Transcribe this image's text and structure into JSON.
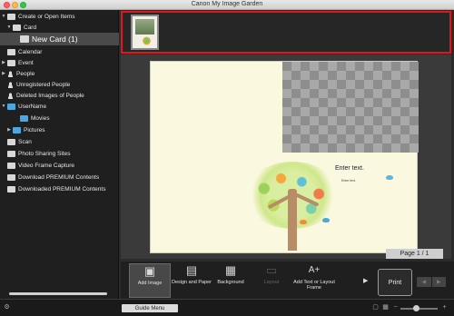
{
  "window": {
    "title": "Canon My Image Garden"
  },
  "sidebar": {
    "items": [
      {
        "label": "Create or Open Items",
        "arrow": "▼",
        "icon": "document-icon"
      },
      {
        "label": "Card",
        "arrow": "▼",
        "icon": "card-icon"
      },
      {
        "label": "New Card (1)",
        "arrow": "",
        "icon": "card-doc-icon"
      },
      {
        "label": "Calendar",
        "arrow": "",
        "icon": "calendar-icon"
      },
      {
        "label": "Event",
        "arrow": "▶",
        "icon": "event-icon"
      },
      {
        "label": "People",
        "arrow": "▶",
        "icon": "people-icon"
      },
      {
        "label": "Unregistered People",
        "arrow": "",
        "icon": "person-icon"
      },
      {
        "label": "Deleted Images of People",
        "arrow": "",
        "icon": "person-icon"
      },
      {
        "label": "UserName",
        "arrow": "▼",
        "icon": "computer-icon"
      },
      {
        "label": "Movies",
        "arrow": "",
        "icon": "folder-icon"
      },
      {
        "label": "Pictures",
        "arrow": "▶",
        "icon": "folder-icon"
      },
      {
        "label": "Scan",
        "arrow": "",
        "icon": "scan-icon"
      },
      {
        "label": "Photo Sharing Sites",
        "arrow": "",
        "icon": "photo-sharing-icon"
      },
      {
        "label": "Video Frame Capture",
        "arrow": "",
        "icon": "video-icon"
      },
      {
        "label": "Download PREMIUM Contents",
        "arrow": "",
        "icon": "download-icon"
      },
      {
        "label": "Downloaded PREMIUM Contents",
        "arrow": "",
        "icon": "downloaded-icon"
      }
    ]
  },
  "canvas": {
    "text_placeholder": "Enter text.",
    "text_placeholder_small": "Enter text.",
    "page_indicator": "Page 1 / 1"
  },
  "toolbar": {
    "add_image": "Add Image",
    "design_and_paper": "Design and Paper",
    "background": "Background",
    "layout": "Layout",
    "add_text_frame": "Add Text or Layout Frame",
    "print": "Print",
    "more_arrow": "▶",
    "prev": "◀",
    "next": "▶"
  },
  "statusbar": {
    "guide_menu": "Guide Menu"
  }
}
